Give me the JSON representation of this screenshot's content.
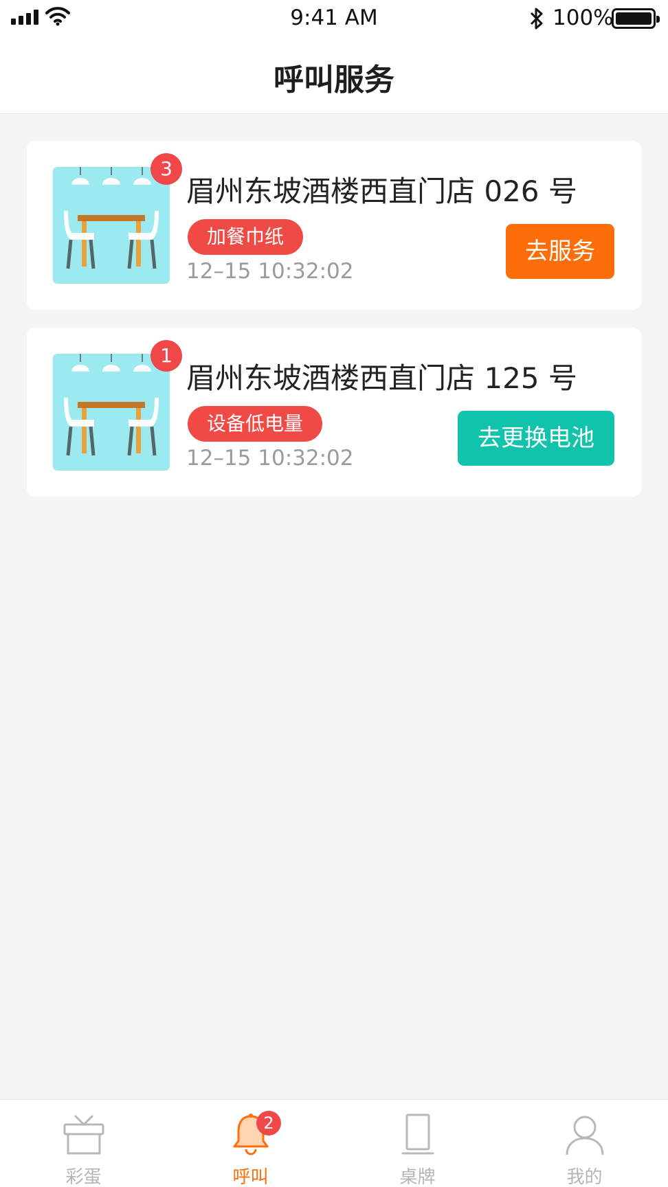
{
  "status_bar": {
    "time": "9:41 AM",
    "battery_percent": "100%",
    "signal_icon": "signal-bars-icon",
    "wifi_icon": "wifi-icon",
    "bluetooth_icon": "bluetooth-icon",
    "battery_icon": "battery-full-icon"
  },
  "nav": {
    "title": "呼叫服务"
  },
  "calls": [
    {
      "title": "眉州东坡酒楼西直门店 026 号",
      "count": "3",
      "tag": "加餐巾纸",
      "time": "12–15 10:32:02",
      "action": "去服务",
      "action_color": "#fb6e0a",
      "thumb_icon": "dining-table-icon"
    },
    {
      "title": "眉州东坡酒楼西直门店 125 号",
      "count": "1",
      "tag": "设备低电量",
      "time": "12–15 10:32:02",
      "action": "去更换电池",
      "action_color": "#12c3ab",
      "thumb_icon": "dining-table-icon"
    }
  ],
  "tabbar": {
    "items": [
      {
        "label": "彩蛋",
        "icon": "gift-icon",
        "active": false
      },
      {
        "label": "呼叫",
        "icon": "bell-icon",
        "active": true,
        "badge": "2"
      },
      {
        "label": "桌牌",
        "icon": "table-card-icon",
        "active": false
      },
      {
        "label": "我的",
        "icon": "user-icon",
        "active": false
      }
    ]
  },
  "colors": {
    "accent": "#fb6e0a",
    "teal": "#12c3ab",
    "badge_red": "#f04848",
    "tag_red": "#f04a46",
    "thumb_bg": "#9beaf0"
  }
}
